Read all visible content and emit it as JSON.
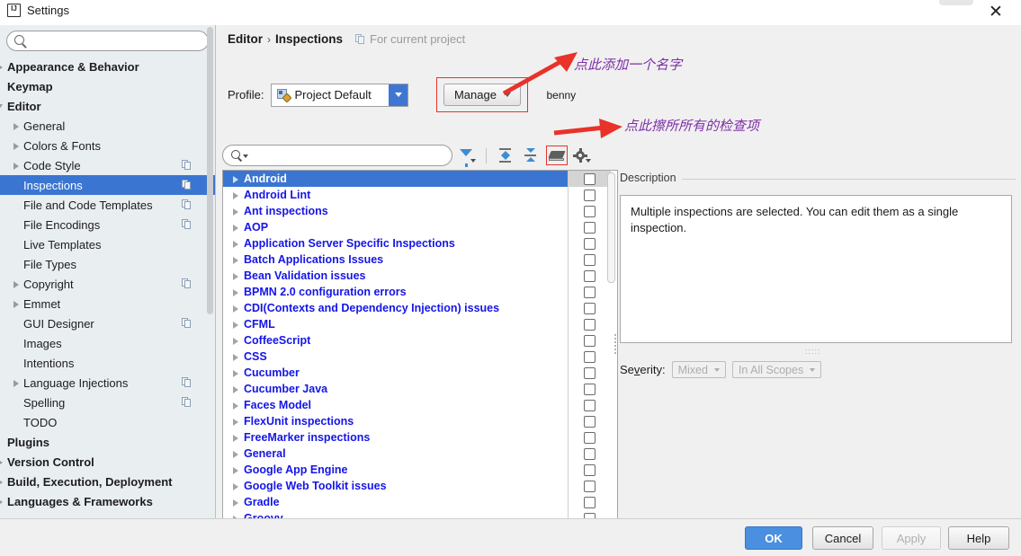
{
  "window": {
    "title": "Settings",
    "logo_icon": "intellij-logo-icon",
    "close_icon": "close-icon"
  },
  "sidebar": {
    "search_placeholder": "",
    "search_value": "",
    "items": [
      {
        "label": "Appearance & Behavior",
        "level": 0,
        "bold": true,
        "twisty": "right",
        "copy": false,
        "selected": false
      },
      {
        "label": "Keymap",
        "level": 0,
        "bold": true,
        "twisty": "none",
        "copy": false,
        "selected": false
      },
      {
        "label": "Editor",
        "level": 0,
        "bold": true,
        "twisty": "down",
        "copy": false,
        "selected": false
      },
      {
        "label": "General",
        "level": 1,
        "bold": false,
        "twisty": "right",
        "copy": false,
        "selected": false
      },
      {
        "label": "Colors & Fonts",
        "level": 1,
        "bold": false,
        "twisty": "right",
        "copy": false,
        "selected": false
      },
      {
        "label": "Code Style",
        "level": 1,
        "bold": false,
        "twisty": "right",
        "copy": true,
        "selected": false
      },
      {
        "label": "Inspections",
        "level": 1,
        "bold": false,
        "twisty": "none",
        "copy": true,
        "selected": true
      },
      {
        "label": "File and Code Templates",
        "level": 1,
        "bold": false,
        "twisty": "none",
        "copy": true,
        "selected": false
      },
      {
        "label": "File Encodings",
        "level": 1,
        "bold": false,
        "twisty": "none",
        "copy": true,
        "selected": false
      },
      {
        "label": "Live Templates",
        "level": 1,
        "bold": false,
        "twisty": "none",
        "copy": false,
        "selected": false
      },
      {
        "label": "File Types",
        "level": 1,
        "bold": false,
        "twisty": "none",
        "copy": false,
        "selected": false
      },
      {
        "label": "Copyright",
        "level": 1,
        "bold": false,
        "twisty": "right",
        "copy": true,
        "selected": false
      },
      {
        "label": "Emmet",
        "level": 1,
        "bold": false,
        "twisty": "right",
        "copy": false,
        "selected": false
      },
      {
        "label": "GUI Designer",
        "level": 1,
        "bold": false,
        "twisty": "none",
        "copy": true,
        "selected": false
      },
      {
        "label": "Images",
        "level": 1,
        "bold": false,
        "twisty": "none",
        "copy": false,
        "selected": false
      },
      {
        "label": "Intentions",
        "level": 1,
        "bold": false,
        "twisty": "none",
        "copy": false,
        "selected": false
      },
      {
        "label": "Language Injections",
        "level": 1,
        "bold": false,
        "twisty": "right",
        "copy": true,
        "selected": false
      },
      {
        "label": "Spelling",
        "level": 1,
        "bold": false,
        "twisty": "none",
        "copy": true,
        "selected": false
      },
      {
        "label": "TODO",
        "level": 1,
        "bold": false,
        "twisty": "none",
        "copy": false,
        "selected": false
      },
      {
        "label": "Plugins",
        "level": 0,
        "bold": true,
        "twisty": "none",
        "copy": false,
        "selected": false
      },
      {
        "label": "Version Control",
        "level": 0,
        "bold": true,
        "twisty": "right",
        "copy": false,
        "selected": false
      },
      {
        "label": "Build, Execution, Deployment",
        "level": 0,
        "bold": true,
        "twisty": "right",
        "copy": false,
        "selected": false
      },
      {
        "label": "Languages & Frameworks",
        "level": 0,
        "bold": true,
        "twisty": "right",
        "copy": false,
        "selected": false
      }
    ]
  },
  "header": {
    "crumb_parent": "Editor",
    "crumb_separator": "›",
    "crumb_current": "Inspections",
    "scope_note": "For current project",
    "scope_icon": "copy-project-icon"
  },
  "profile_row": {
    "label": "Profile:",
    "selected_profile": "Project Default",
    "profile_icon": "profile-settings-icon",
    "dropdown_icon": "chevron-down-icon",
    "manage_label": "Manage",
    "manage_caret_icon": "chevron-down-icon",
    "user": "benny"
  },
  "toolbar": {
    "filter_placeholder": "",
    "filter_value": "",
    "search_icon": "search-icon",
    "icons": [
      {
        "name": "filter-funnel-icon",
        "tooltip": "Filter inspections"
      },
      {
        "name": "expand-all-icon",
        "tooltip": "Expand all"
      },
      {
        "name": "collapse-all-icon",
        "tooltip": "Collapse all"
      },
      {
        "name": "eraser-icon",
        "tooltip": "Reset to empty"
      },
      {
        "name": "gear-icon",
        "tooltip": "Options"
      }
    ]
  },
  "inspections": {
    "selected_index": 0,
    "rows": [
      {
        "label": "Android",
        "checked": false
      },
      {
        "label": "Android Lint",
        "checked": false
      },
      {
        "label": "Ant inspections",
        "checked": false
      },
      {
        "label": "AOP",
        "checked": false
      },
      {
        "label": "Application Server Specific Inspections",
        "checked": false
      },
      {
        "label": "Batch Applications Issues",
        "checked": false
      },
      {
        "label": "Bean Validation issues",
        "checked": false
      },
      {
        "label": "BPMN 2.0 configuration errors",
        "checked": false
      },
      {
        "label": "CDI(Contexts and Dependency Injection) issues",
        "checked": false
      },
      {
        "label": "CFML",
        "checked": false
      },
      {
        "label": "CoffeeScript",
        "checked": false
      },
      {
        "label": "CSS",
        "checked": false
      },
      {
        "label": "Cucumber",
        "checked": false
      },
      {
        "label": "Cucumber Java",
        "checked": false
      },
      {
        "label": "Faces Model",
        "checked": false
      },
      {
        "label": "FlexUnit inspections",
        "checked": false
      },
      {
        "label": "FreeMarker inspections",
        "checked": false
      },
      {
        "label": "General",
        "checked": false
      },
      {
        "label": "Google App Engine",
        "checked": false
      },
      {
        "label": "Google Web Toolkit issues",
        "checked": false
      },
      {
        "label": "Gradle",
        "checked": false
      },
      {
        "label": "Groovy",
        "checked": false
      }
    ]
  },
  "description": {
    "group_label": "Description",
    "text": "Multiple inspections are selected. You can edit them as a single inspection.",
    "severity_label": "Severity:",
    "severity_value": "Mixed",
    "scope_value": "In All Scopes"
  },
  "annotations": [
    {
      "text": "点此添加一个名字",
      "color": "#7e2ea8"
    },
    {
      "text": "点此擦所所有的检查项",
      "color": "#7e2ea8"
    }
  ],
  "footer": {
    "ok": "OK",
    "cancel": "Cancel",
    "apply": "Apply",
    "help": "Help"
  },
  "colors": {
    "accent": "#3a76d1",
    "list_item": "#1515e8",
    "annotation": "#7e2ea8",
    "highlight_box": "#e8322a",
    "arrow": "#e8322a"
  }
}
